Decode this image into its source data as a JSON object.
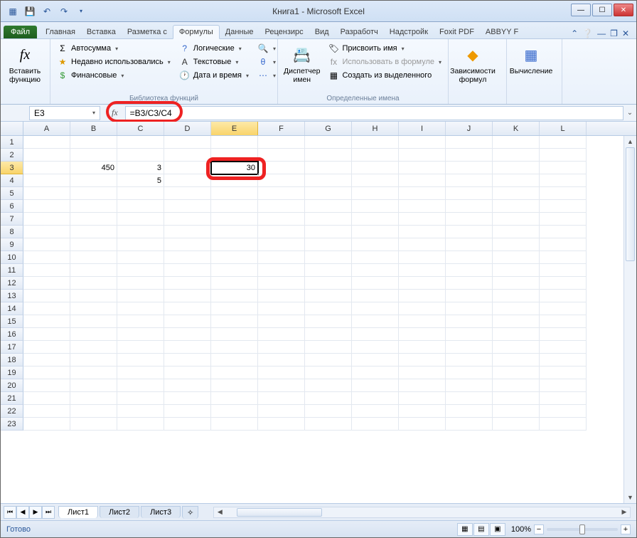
{
  "window": {
    "title": "Книга1 - Microsoft Excel"
  },
  "qat": {
    "save_tip": "Сохранить",
    "undo_tip": "Отменить",
    "redo_tip": "Повторить"
  },
  "tabs": {
    "file": "Файл",
    "items": [
      "Главная",
      "Вставка",
      "Разметка с",
      "Формулы",
      "Данные",
      "Рецензирс",
      "Вид",
      "Разработч",
      "Надстройк",
      "Foxit PDF",
      "ABBYY F"
    ],
    "active_index": 3
  },
  "ribbon": {
    "insert_fn": {
      "label": "Вставить\nфункцию",
      "icon": "fx"
    },
    "lib": {
      "autosum": "Автосумма",
      "recent": "Недавно использовались",
      "financial": "Финансовые",
      "logical": "Логические",
      "text": "Текстовые",
      "datetime": "Дата и время",
      "label": "Библиотека функций"
    },
    "names": {
      "manager": "Диспетчер\nимен",
      "assign": "Присвоить имя",
      "use": "Использовать в формуле",
      "create": "Создать из выделенного",
      "label": "Определенные имена"
    },
    "deps": {
      "label": "Зависимости\nформул"
    },
    "calc": {
      "label": "Вычисление"
    }
  },
  "formula_bar": {
    "name_box": "E3",
    "fx": "fx",
    "formula": "=B3/C3/C4"
  },
  "grid": {
    "columns": [
      "A",
      "B",
      "C",
      "D",
      "E",
      "F",
      "G",
      "H",
      "I",
      "J",
      "K",
      "L"
    ],
    "active_col": "E",
    "rows": 23,
    "active_row": 3,
    "cells": {
      "B3": "450",
      "C3": "3",
      "C4": "5",
      "E3": "30"
    },
    "active_cell": "E3"
  },
  "sheets": {
    "nav": [
      "⏮",
      "◀",
      "▶",
      "⏭"
    ],
    "tabs": [
      "Лист1",
      "Лист2",
      "Лист3"
    ],
    "active": 0
  },
  "status": {
    "ready": "Готово",
    "zoom": "100%"
  }
}
